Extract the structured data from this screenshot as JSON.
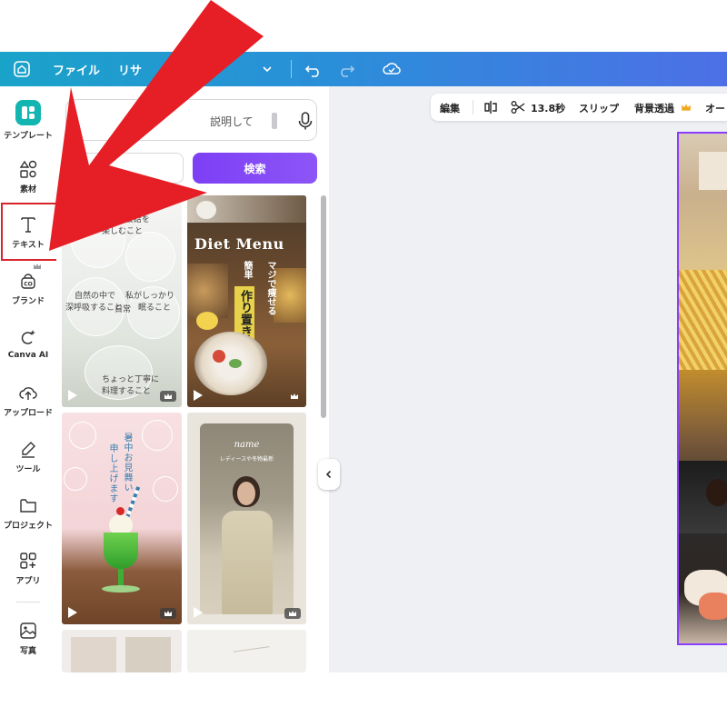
{
  "topbar": {
    "menu_file": "ファイル",
    "menu_resize": "リサ"
  },
  "rail": {
    "items": [
      {
        "label": "テンプレート",
        "icon": "template-icon"
      },
      {
        "label": "素材",
        "icon": "elements-icon"
      },
      {
        "label": "テキスト",
        "icon": "text-icon"
      },
      {
        "label": "ブランド",
        "icon": "brand-icon"
      },
      {
        "label": "Canva AI",
        "icon": "canva-ai-icon"
      },
      {
        "label": "アップロード",
        "icon": "upload-icon"
      },
      {
        "label": "ツール",
        "icon": "tools-icon"
      },
      {
        "label": "プロジェクト",
        "icon": "folder-icon"
      },
      {
        "label": "アプリ",
        "icon": "apps-icon"
      },
      {
        "label": "写真",
        "icon": "photo-icon"
      }
    ],
    "highlight_color": "#d8232a"
  },
  "panel": {
    "search_text": "説明して",
    "search_button": "検索",
    "templates": [
      {
        "lines": [
          "友達との会話を",
          "楽しむこと",
          "自然の中で",
          "深呼吸すること",
          "私がしっかり",
          "眠ること",
          "日常",
          "ちょっと丁寧に",
          "料理すること"
        ]
      },
      {
        "title": "Diet Menu",
        "banner": "作り置き",
        "side": "マジで痩せる",
        "top": "簡単"
      },
      {
        "lines": [
          "暑中お見舞い",
          "申し上げます"
        ]
      },
      {
        "brand": "name",
        "caption": "レディースや冬物最新"
      }
    ]
  },
  "toolbar": {
    "edit": "編集",
    "duration": "13.8秒",
    "slip": "スリップ",
    "bg_remove": "背景透過",
    "more": "オー"
  },
  "colors": {
    "accent": "#8b3dff",
    "topbar_start": "#1aa3c9",
    "topbar_end": "#4d6fe6",
    "arrow": "#e61e25"
  }
}
